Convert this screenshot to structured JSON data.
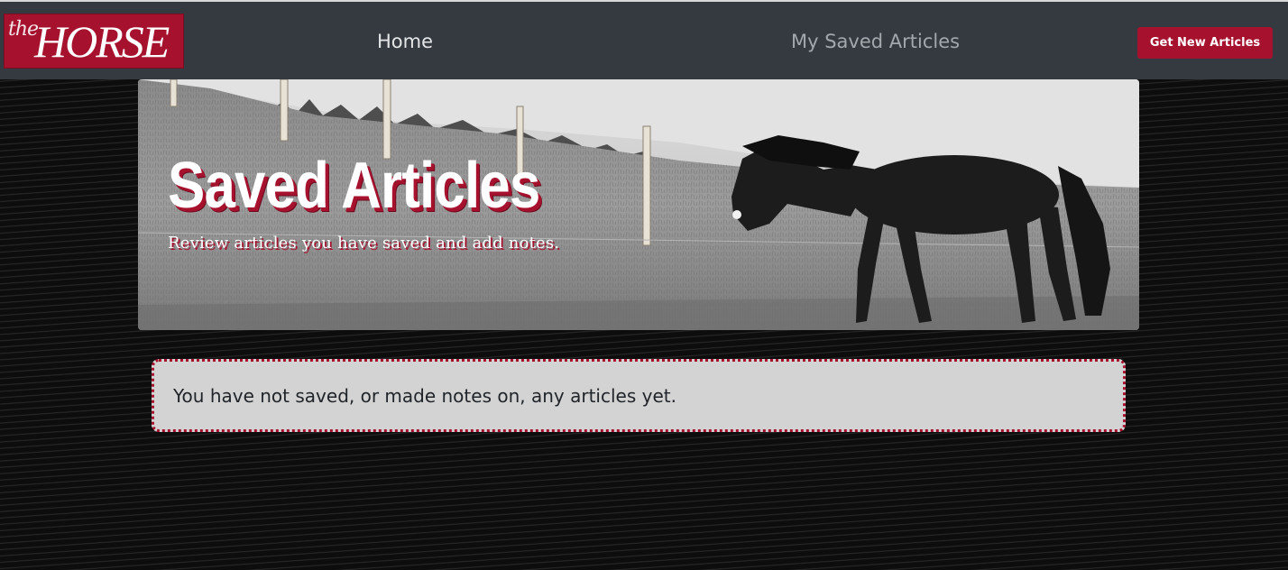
{
  "header": {
    "logo": {
      "prefix": "the",
      "name": "HORSE"
    },
    "nav": {
      "home_label": "Home",
      "saved_label": "My Saved Articles"
    },
    "action_label": "Get New Articles"
  },
  "hero": {
    "title": "Saved Articles",
    "subtitle": "Review articles you have saved and add notes."
  },
  "notice": {
    "message": "You have not saved, or made notes on, any articles yet."
  },
  "colors": {
    "brand": "#a6112e",
    "navbar": "#343a40",
    "notice_bg": "#d3d3d3",
    "page_bg": "#0d0d0d"
  }
}
